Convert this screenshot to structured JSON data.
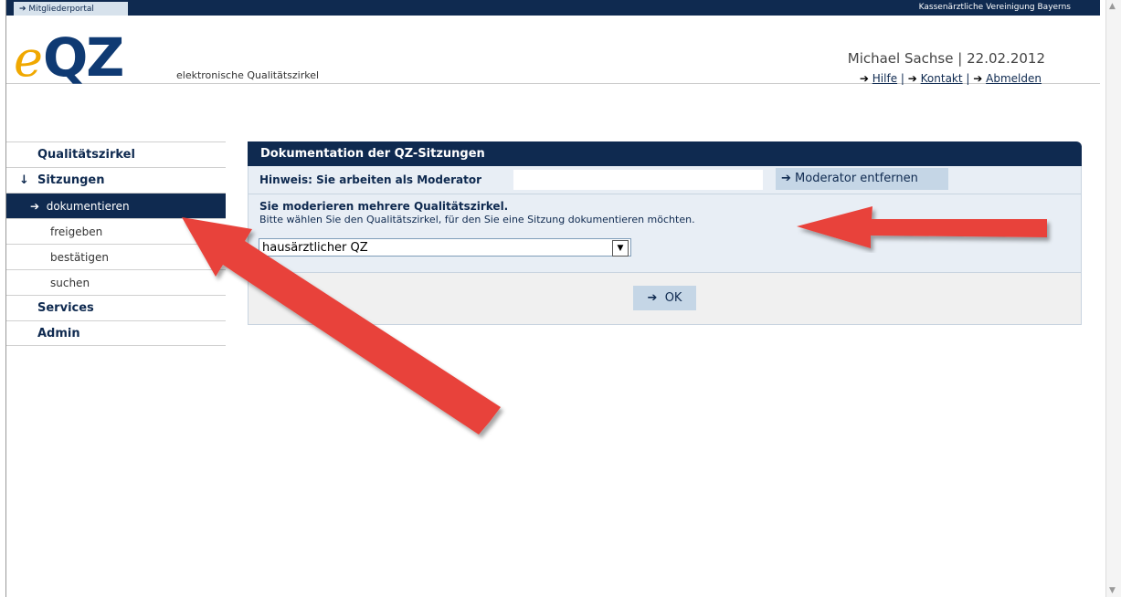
{
  "topbar": {
    "portal_label": "Mitgliederportal",
    "org_name": "Kassenärztliche Vereinigung Bayerns"
  },
  "header": {
    "logo_e": "e",
    "logo_qz": "QZ",
    "tagline": "elektronische Qualitätszirkel",
    "user_name": "Michael Sachse",
    "separator": "|",
    "date": "22.02.2012",
    "links": [
      {
        "label": "Hilfe"
      },
      {
        "label": "Kontakt"
      },
      {
        "label": "Abmelden"
      }
    ]
  },
  "sidebar": {
    "items": [
      {
        "label": "Qualitätszirkel"
      },
      {
        "label": "Sitzungen"
      },
      {
        "label": "dokumentieren"
      },
      {
        "label": "freigeben"
      },
      {
        "label": "bestätigen"
      },
      {
        "label": "suchen"
      },
      {
        "label": "Services"
      },
      {
        "label": "Admin"
      }
    ]
  },
  "panel": {
    "title": "Dokumentation der QZ-Sitzungen",
    "hint_label": "Hinweis: Sie arbeiten als Moderator",
    "remove_moderator_button": "Moderator entfernen",
    "select_title": "Sie moderieren mehrere Qualitätszirkel.",
    "select_description": "Bitte wählen Sie den Qualitätszirkel, für den Sie eine Sitzung dokumentieren möchten.",
    "select_value": "hausärztlicher QZ",
    "ok_button": "OK"
  },
  "colors": {
    "navy": "#0f2a50",
    "logo_orange": "#f0a800",
    "logo_blue": "#0f3a73",
    "annotation_arrow": "#e8423a"
  }
}
